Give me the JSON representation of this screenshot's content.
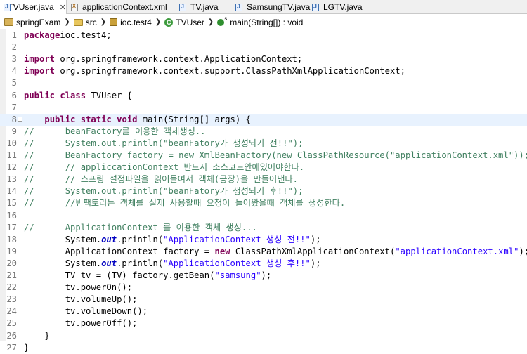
{
  "tabs": [
    {
      "label": "TVUser.java",
      "icon": "java-file-icon",
      "active": true,
      "close": "✕"
    },
    {
      "label": "applicationContext.xml",
      "icon": "xml-file-icon"
    },
    {
      "label": "TV.java",
      "icon": "java-file-icon"
    },
    {
      "label": "SamsungTV.java",
      "icon": "java-file-icon"
    },
    {
      "label": "LGTV.java",
      "icon": "java-file-icon"
    }
  ],
  "breadcrumb": [
    {
      "label": "springExam",
      "icon": "project-icon"
    },
    {
      "label": "src",
      "icon": "source-folder-icon"
    },
    {
      "label": "ioc.test4",
      "icon": "package-icon"
    },
    {
      "label": "TVUser",
      "icon": "class-icon"
    },
    {
      "label": "main(String[]) : void",
      "icon": "static-method-icon"
    }
  ],
  "editor": {
    "current_line": 8,
    "lines": [
      {
        "n": "1",
        "t": [
          [
            "kw",
            "package"
          ],
          [
            "",
            "ioc.test4;"
          ]
        ]
      },
      {
        "n": "2",
        "t": []
      },
      {
        "n": "3",
        "t": [
          [
            "kw",
            "import"
          ],
          [
            "",
            " org.springframework.context.ApplicationContext;"
          ]
        ]
      },
      {
        "n": "4",
        "t": [
          [
            "kw",
            "import"
          ],
          [
            "",
            " org.springframework.context.support.ClassPathXmlApplicationContext;"
          ]
        ]
      },
      {
        "n": "5",
        "t": []
      },
      {
        "n": "6",
        "t": [
          [
            "kw",
            "public"
          ],
          [
            "",
            " "
          ],
          [
            "kw",
            "class"
          ],
          [
            "",
            " TVUser {"
          ]
        ]
      },
      {
        "n": "7",
        "t": []
      },
      {
        "n": "8",
        "t": [
          [
            "",
            "    "
          ],
          [
            "kw",
            "public"
          ],
          [
            "",
            " "
          ],
          [
            "kw",
            "static"
          ],
          [
            "",
            " "
          ],
          [
            "kw",
            "void"
          ],
          [
            "",
            " main(String[] args) {"
          ]
        ]
      },
      {
        "n": "9",
        "t": [
          [
            "cm",
            "//      beanFactory를 이용한 객체생성.."
          ]
        ]
      },
      {
        "n": "10",
        "t": [
          [
            "cm",
            "//      System.out.println(\"beanFatory가 생성되기 전!!\");"
          ]
        ]
      },
      {
        "n": "11",
        "t": [
          [
            "cm",
            "//      BeanFactory factory = new XmlBeanFactory(new ClassPathResource(\"applicationContext.xml\"));"
          ]
        ]
      },
      {
        "n": "12",
        "t": [
          [
            "cm",
            "//      // appliccationContext 반드시 소스코드안에있어야한다."
          ]
        ]
      },
      {
        "n": "13",
        "t": [
          [
            "cm",
            "//      // 스프링 설정파일을 읽어들여서 객체(공장)을 만들어낸다."
          ]
        ]
      },
      {
        "n": "14",
        "t": [
          [
            "cm",
            "//      System.out.println(\"beanFatory가 생성되기 후!!\");"
          ]
        ]
      },
      {
        "n": "15",
        "t": [
          [
            "cm",
            "//      //빈팩토리는 객체를 실제 사용할때 요청이 들어왔을때 객체를 생성한다."
          ]
        ]
      },
      {
        "n": "16",
        "t": []
      },
      {
        "n": "17",
        "t": [
          [
            "cm",
            "//      ApplicationContext 를 이용한 객체 생성..."
          ]
        ]
      },
      {
        "n": "18",
        "t": [
          [
            "",
            "        System."
          ],
          [
            "fld",
            "out"
          ],
          [
            "",
            ".println("
          ],
          [
            "str",
            "\"ApplicationContext 생성 전!!\""
          ],
          [
            "",
            ");"
          ]
        ]
      },
      {
        "n": "19",
        "t": [
          [
            "",
            "        ApplicationContext factory = "
          ],
          [
            "kw",
            "new"
          ],
          [
            "",
            " ClassPathXmlApplicationContext("
          ],
          [
            "str",
            "\"applicationContext.xml\""
          ],
          [
            "",
            ");"
          ]
        ]
      },
      {
        "n": "20",
        "t": [
          [
            "",
            "        System."
          ],
          [
            "fld",
            "out"
          ],
          [
            "",
            ".println("
          ],
          [
            "str",
            "\"ApplicationContext 생성 후!!\""
          ],
          [
            "",
            ");"
          ]
        ]
      },
      {
        "n": "21",
        "t": [
          [
            "",
            "        TV tv = (TV) factory.getBean("
          ],
          [
            "str",
            "\"samsung\""
          ],
          [
            "",
            ");"
          ]
        ]
      },
      {
        "n": "22",
        "t": [
          [
            "",
            "        tv.powerOn();"
          ]
        ]
      },
      {
        "n": "23",
        "t": [
          [
            "",
            "        tv.volumeUp();"
          ]
        ]
      },
      {
        "n": "24",
        "t": [
          [
            "",
            "        tv.volumeDown();"
          ]
        ]
      },
      {
        "n": "25",
        "t": [
          [
            "",
            "        tv.powerOff();"
          ]
        ]
      },
      {
        "n": "26",
        "t": [
          [
            "",
            "    }"
          ]
        ]
      },
      {
        "n": "27",
        "t": [
          [
            "",
            "}"
          ]
        ]
      }
    ]
  }
}
